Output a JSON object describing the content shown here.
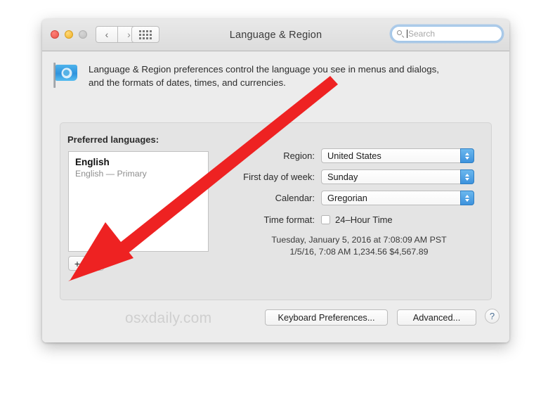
{
  "window": {
    "title": "Language & Region",
    "traffic_lights": [
      "close",
      "minimize",
      "zoom"
    ],
    "nav": {
      "back": "‹",
      "forward": "›"
    },
    "grid_button": "show-all",
    "search": {
      "placeholder": "Search",
      "value": ""
    }
  },
  "description": {
    "line1": "Language & Region preferences control the language you see in menus and dialogs,",
    "line2": "and the formats of dates, times, and currencies.",
    "icon": "un-flag-icon"
  },
  "panel": {
    "preferred_languages_label": "Preferred languages:",
    "languages": [
      {
        "name": "English",
        "detail": "English — Primary"
      }
    ],
    "add_button": "+",
    "remove_button": "—",
    "fields": [
      {
        "label": "Region:",
        "value": "United States"
      },
      {
        "label": "First day of week:",
        "value": "Sunday"
      },
      {
        "label": "Calendar:",
        "value": "Gregorian"
      }
    ],
    "time_format": {
      "label": "Time format:",
      "checkbox_label": "24–Hour Time",
      "checked": false
    },
    "preview": {
      "line1": "Tuesday, January 5, 2016 at 7:08:09 AM PST",
      "line2": "1/5/16, 7:08 AM     1,234.56     $4,567.89"
    }
  },
  "footer": {
    "keyboard_preferences": "Keyboard Preferences...",
    "advanced": "Advanced...",
    "help": "?",
    "watermark": "osxdaily.com"
  },
  "annotation": {
    "type": "red-arrow",
    "color": "#ee2222",
    "points_to": "add-language-button"
  }
}
